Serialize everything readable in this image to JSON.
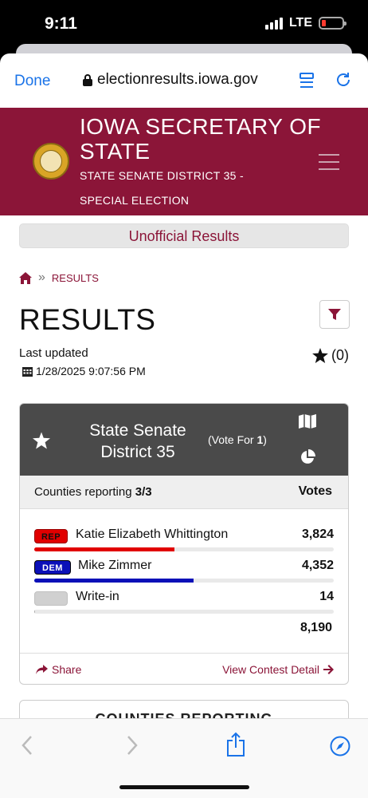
{
  "status": {
    "time": "9:11",
    "network": "LTE"
  },
  "browser": {
    "done_label": "Done",
    "url": "electionresults.iowa.gov"
  },
  "site": {
    "title": "IOWA SECRETARY OF STATE",
    "subtitle": "STATE SENATE DISTRICT 35 - SPECIAL ELECTION",
    "brand_color": "#8b1538"
  },
  "banner": "Unofficial Results",
  "breadcrumb": {
    "current": "RESULTS"
  },
  "page_title": "RESULTS",
  "updated": {
    "label": "Last updated",
    "datetime": "1/28/2025 9:07:56 PM"
  },
  "favorites": {
    "count_label": "(0)"
  },
  "contest": {
    "name": "State Senate District 35",
    "vote_for_prefix": "(Vote For ",
    "vote_for_number": "1",
    "vote_for_suffix": ")",
    "reporting_label": "Counties reporting ",
    "reporting_value": "3/3",
    "votes_header": "Votes",
    "candidates": [
      {
        "party": "REP",
        "name": "Katie Elizabeth Whittington",
        "votes": "3,824",
        "share": 0.467,
        "color": "#e10000"
      },
      {
        "party": "DEM",
        "name": "Mike Zimmer",
        "votes": "4,352",
        "share": 0.531,
        "color": "#0b10b8"
      },
      {
        "party": "",
        "name": "Write-in",
        "votes": "14",
        "share": 0.002,
        "color": "#aaaaaa"
      }
    ],
    "total": "8,190",
    "share_label": "Share",
    "detail_label": "View Contest Detail"
  },
  "next_card_title": "COUNTIES REPORTING"
}
